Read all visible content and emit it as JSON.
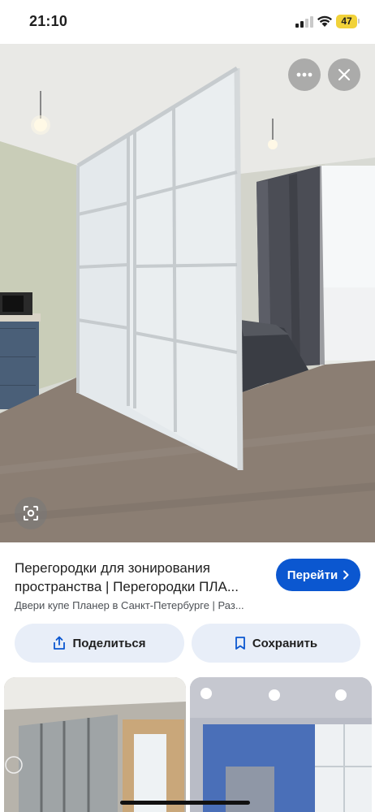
{
  "status_bar": {
    "time": "21:10",
    "battery": "47",
    "icons": [
      "signal-icon",
      "wifi-icon",
      "battery-icon"
    ]
  },
  "viewer": {
    "image_subject": "room-divider-photo",
    "buttons": [
      "more-icon",
      "close-icon",
      "lens-icon"
    ]
  },
  "result": {
    "title_line1": "Перегородки для зонирования",
    "title_line2": "пространства | Перегородки ПЛА...",
    "source": "Двери купе Планер в Санкт-Петербурге | Раз...",
    "visit_label": "Перейти"
  },
  "actions": {
    "share_label": "Поделиться",
    "save_label": "Сохранить"
  },
  "colors": {
    "accent": "#0b57d0",
    "action_bg": "#e8eef8",
    "battery": "#f1d23a"
  }
}
